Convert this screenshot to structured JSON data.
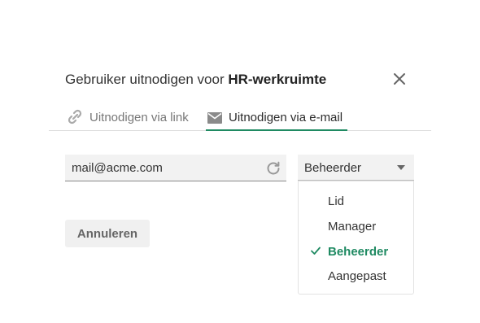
{
  "dialog": {
    "title_prefix": "Gebruiker uitnodigen voor ",
    "workspace_name": "HR-werkruimte"
  },
  "tabs": [
    {
      "label": "Uitnodigen via link",
      "icon": "link-icon",
      "active": false
    },
    {
      "label": "Uitnodigen via e-mail",
      "icon": "mail-icon",
      "active": true
    }
  ],
  "email_field": {
    "value": "mail@acme.com",
    "icon": "refresh-icon"
  },
  "role_select": {
    "selected": "Beheerder",
    "options": [
      {
        "label": "Lid",
        "selected": false
      },
      {
        "label": "Manager",
        "selected": false
      },
      {
        "label": "Beheerder",
        "selected": true
      },
      {
        "label": "Aangepast",
        "selected": false
      }
    ]
  },
  "actions": {
    "cancel_label": "Annuleren"
  },
  "colors": {
    "accent": "#1f8a62",
    "field_bg": "#f2f2f2"
  }
}
